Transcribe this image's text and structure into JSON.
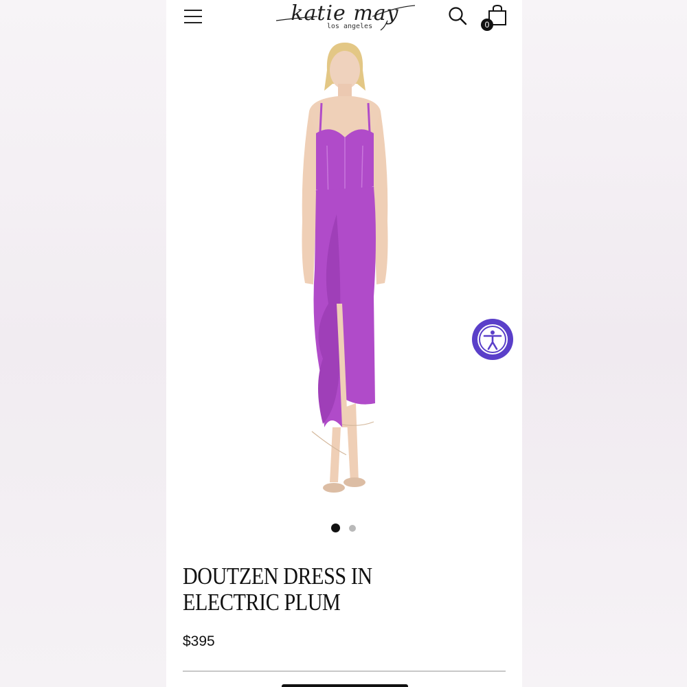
{
  "header": {
    "menu_icon": "hamburger-menu-icon",
    "logo_text": "katie may",
    "logo_subtext": "los angeles",
    "search_icon": "search-icon",
    "cart_icon": "shopping-bag-icon",
    "cart_count": "0"
  },
  "gallery": {
    "image_alt": "Model wearing purple corset midi dress with ruffle slit",
    "image_count": 2,
    "active_index": 0,
    "dress_color": "#b04bc9"
  },
  "accessibility": {
    "icon": "accessibility-person-icon",
    "color": "#5a3fc9"
  },
  "product": {
    "title": "DOUTZEN DRESS IN ELECTRIC PLUM",
    "price": "$395"
  }
}
